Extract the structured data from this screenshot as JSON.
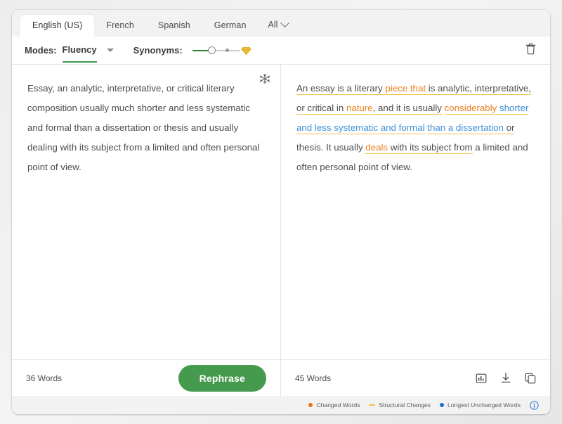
{
  "tabs": [
    {
      "label": "English (US)",
      "active": true
    },
    {
      "label": "French",
      "active": false
    },
    {
      "label": "Spanish",
      "active": false
    },
    {
      "label": "German",
      "active": false
    }
  ],
  "tab_all": {
    "label": "All",
    "icon": "chevron-down-icon"
  },
  "toolbar": {
    "modes_label": "Modes:",
    "mode_value": "Fluency",
    "synonyms_label": "Synonyms:",
    "synonyms_level": 30,
    "premium_icon": "diamond-icon",
    "delete_icon": "trash-icon"
  },
  "left_panel": {
    "freeze_icon": "snowflake-icon",
    "text": "Essay, an analytic, interpretative, or critical literary composition usually much shorter and less systematic and formal than a dissertation or thesis and usually dealing with its subject from a limited and often personal point of view.",
    "word_count": "36 Words",
    "rephrase_label": "Rephrase"
  },
  "right_panel": {
    "word_count": "45 Words",
    "icons": [
      "stats-icon",
      "download-icon",
      "copy-icon"
    ],
    "segments": [
      {
        "text": "An essay is a literary ",
        "type": "struct"
      },
      {
        "text": "piece that",
        "type": "changed-struct"
      },
      {
        "text": " is analytic,",
        "type": "struct"
      },
      {
        "text": " interpretative, or critical in ",
        "type": "struct"
      },
      {
        "text": "nature",
        "type": "changed-struct"
      },
      {
        "text": ", and it is usually",
        "type": "struct"
      },
      {
        "text": " ",
        "type": "plain"
      },
      {
        "text": "considerably",
        "type": "changed-struct"
      },
      {
        "text": " ",
        "type": "struct"
      },
      {
        "text": "shorter and less systematic and formal",
        "type": "unchanged-struct"
      },
      {
        "text": " ",
        "type": "plain"
      },
      {
        "text": "than a dissertation",
        "type": "unchanged-struct"
      },
      {
        "text": " or",
        "type": "struct"
      },
      {
        "text": " thesis. It usually ",
        "type": "plain"
      },
      {
        "text": "deals",
        "type": "changed-struct"
      },
      {
        "text": " with its",
        "type": "struct"
      },
      {
        "text": " subject from",
        "type": "struct"
      },
      {
        "text": " a limited and often personal point of view.",
        "type": "plain"
      }
    ],
    "plain_text": "An essay is a literary piece that is analytic, interpretative, or critical in nature, and it is usually considerably shorter and less systematic and formal than a dissertation or thesis. It usually deals with its subject from a limited and often personal point of view."
  },
  "legend": {
    "items": [
      {
        "label": "Changed Words",
        "marker": "dot",
        "color": "#e8721c"
      },
      {
        "label": "Structural Changes",
        "marker": "dash",
        "color": "#f2c14a"
      },
      {
        "label": "Longest Unchanged Words",
        "marker": "dot",
        "color": "#1a6fd4"
      }
    ],
    "info_icon": "info-icon"
  },
  "colors": {
    "accent_green": "#469a4e",
    "changed": "#e98123",
    "unchanged": "#3d8fd6",
    "structural": "#f2c14a"
  }
}
